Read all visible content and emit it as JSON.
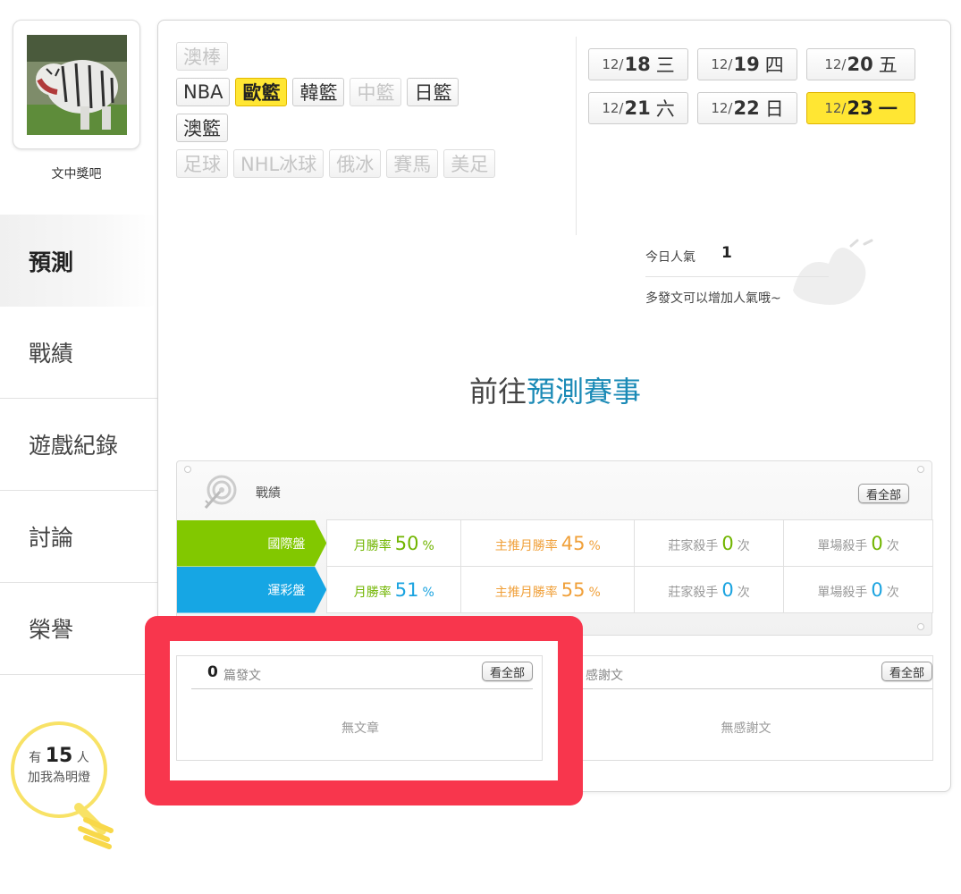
{
  "user": {
    "name": "文中獎吧"
  },
  "sidebar": {
    "items": [
      {
        "label": "預測",
        "active": true
      },
      {
        "label": "戰績",
        "active": false
      },
      {
        "label": "遊戲紀錄",
        "active": false
      },
      {
        "label": "討論",
        "active": false
      },
      {
        "label": "榮譽",
        "active": false
      }
    ]
  },
  "fans": {
    "prefix": "有",
    "count": "15",
    "suffix": "人",
    "line2": "加我為明燈"
  },
  "sports": {
    "rows": [
      [
        {
          "label": "澳棒",
          "state": "disabled"
        }
      ],
      [
        {
          "label": "NBA",
          "state": "normal"
        },
        {
          "label": "歐籃",
          "state": "active"
        },
        {
          "label": "韓籃",
          "state": "normal"
        },
        {
          "label": "中籃",
          "state": "disabled"
        },
        {
          "label": "日籃",
          "state": "normal"
        }
      ],
      [
        {
          "label": "澳籃",
          "state": "normal"
        }
      ],
      [
        {
          "label": "足球",
          "state": "disabled"
        },
        {
          "label": "NHL冰球",
          "state": "disabled"
        },
        {
          "label": "俄冰",
          "state": "disabled"
        },
        {
          "label": "賽馬",
          "state": "disabled"
        },
        {
          "label": "美足",
          "state": "disabled"
        }
      ]
    ]
  },
  "dates": [
    {
      "month": "12/",
      "day": "18",
      "weekday": "三",
      "active": false
    },
    {
      "month": "12/",
      "day": "19",
      "weekday": "四",
      "active": false
    },
    {
      "month": "12/",
      "day": "20",
      "weekday": "五",
      "active": false
    },
    {
      "month": "12/",
      "day": "21",
      "weekday": "六",
      "active": false
    },
    {
      "month": "12/",
      "day": "22",
      "weekday": "日",
      "active": false
    },
    {
      "month": "12/",
      "day": "23",
      "weekday": "一",
      "active": true
    }
  ],
  "popularity": {
    "label": "今日人氣",
    "value": "1",
    "hint": "多發文可以增加人氣哦~"
  },
  "cta": {
    "prefix": "前往",
    "highlight": "預測賽事"
  },
  "stats": {
    "title": "戰績",
    "view_all": "看全部",
    "rows": [
      {
        "market": "國際盤",
        "color": "green",
        "cells": [
          {
            "label": "月勝率",
            "value": "50",
            "unit": "%",
            "label_class": "lbl-green",
            "num_class": "num-green"
          },
          {
            "label": "主推月勝率",
            "value": "45",
            "unit": "%",
            "label_class": "lbl-orange",
            "num_class": "num-orange"
          },
          {
            "label": "莊家殺手",
            "value": "0",
            "unit": "次",
            "label_class": "",
            "num_class": "num-green"
          },
          {
            "label": "單場殺手",
            "value": "0",
            "unit": "次",
            "label_class": "",
            "num_class": "num-green"
          }
        ]
      },
      {
        "market": "運彩盤",
        "color": "blue",
        "cells": [
          {
            "label": "月勝率",
            "value": "51",
            "unit": "%",
            "label_class": "lbl-green",
            "num_class": "num-blue"
          },
          {
            "label": "主推月勝率",
            "value": "55",
            "unit": "%",
            "label_class": "lbl-orange",
            "num_class": "num-orange"
          },
          {
            "label": "莊家殺手",
            "value": "0",
            "unit": "次",
            "label_class": "",
            "num_class": "num-blue"
          },
          {
            "label": "單場殺手",
            "value": "0",
            "unit": "次",
            "label_class": "",
            "num_class": "num-blue"
          }
        ]
      }
    ]
  },
  "posts": {
    "count": "0",
    "label": "篇發文",
    "view_all": "看全部",
    "empty": "無文章"
  },
  "thanks": {
    "label": "感謝文",
    "view_all": "看全部",
    "empty": "無感謝文"
  },
  "colors": {
    "highlight_frame": "#f8364d",
    "active_yellow": "#ffe633",
    "market_green": "#82c800",
    "market_blue": "#16a6e4",
    "cta_blue": "#1a8ab6"
  }
}
